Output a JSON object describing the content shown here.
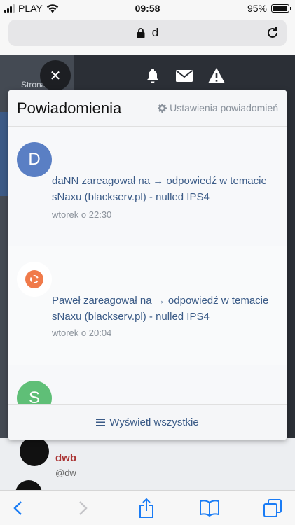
{
  "status_bar": {
    "carrier": "PLAY",
    "time": "09:58",
    "battery": "95%",
    "battery_level": 0.95
  },
  "url_bar": {
    "url": "d"
  },
  "background_page": {
    "label": "Strona",
    "username_fragment": "dwb",
    "handle_fragment": "@dw"
  },
  "header_icons": [
    "bell-icon",
    "envelope-icon",
    "warning-icon"
  ],
  "popup": {
    "title": "Powiadomienia",
    "settings_label": "Ustawienia powiadomień",
    "notifications": [
      {
        "avatar_letter": "D",
        "avatar_color": "#5a7fc4",
        "text": "daNN zareagował na → odpowiedź w temacie sNaxu (blackserv.pl) - nulled IPS4",
        "time": "wtorek o 22:30"
      },
      {
        "avatar_letter": "",
        "avatar_color": "#f07a4a",
        "text": "Paweł zareagował na → odpowiedź w temacie sNaxu (blackserv.pl) - nulled IPS4",
        "time": "wtorek o 20:04"
      },
      {
        "avatar_letter": "S",
        "avatar_color": "#5fbf77",
        "text": "",
        "time": ""
      }
    ],
    "view_all_label": "Wyświetl wszystkie"
  },
  "colors": {
    "link": "#3b5b87",
    "ios_blue": "#1a7cf5"
  }
}
